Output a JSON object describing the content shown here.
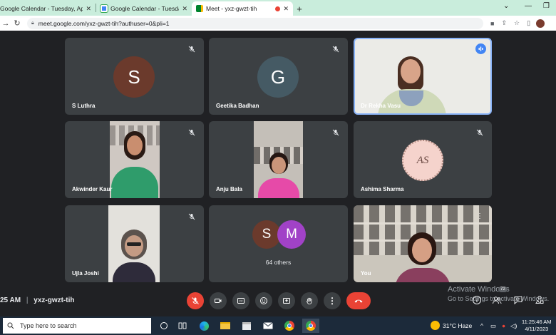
{
  "browser": {
    "tabs": [
      {
        "title": "Google Calendar - Tuesday, April",
        "active": false
      },
      {
        "title": "Google Calendar - Tuesday, April",
        "active": false
      },
      {
        "title": "Meet - yxz-gwzt-tih",
        "active": true
      }
    ],
    "new_tab_label": "+",
    "url": "meet.google.com/yxz-gwzt-tih?authuser=0&pli=1"
  },
  "meeting": {
    "participants": [
      {
        "name": "S Luthra",
        "initial": "S",
        "avatar_color": "#6b3a2c",
        "muted": true
      },
      {
        "name": "Geetika Badhan",
        "initial": "G",
        "avatar_color": "#455a64",
        "muted": true
      },
      {
        "name": "Dr Rekha Vasu",
        "speaking": true
      },
      {
        "name": "Akwinder Kaur",
        "muted": true
      },
      {
        "name": "Anju Bala",
        "muted": true
      },
      {
        "name": "Ashima Sharma",
        "avatar_text": "AS",
        "muted": true
      },
      {
        "name": "Ujla Joshi",
        "muted": true
      },
      {
        "others_label": "64 others",
        "initials": [
          "S",
          "M"
        ]
      },
      {
        "name": "You"
      }
    ],
    "time_fragment": "25 AM",
    "separator": "|",
    "code": "yxz-gwzt-tih",
    "people_count": "72",
    "watermark_line1": "Activate Windows",
    "watermark_line2": "Go to Settings to activate Windows."
  },
  "taskbar": {
    "search_placeholder": "Type here to search",
    "weather": "31°C  Haze",
    "time": "11:25:46 AM",
    "date": "4/11/2023"
  },
  "colors": {
    "accent": "#1a73e8",
    "danger": "#ea4335",
    "tile": "#3c4043",
    "background": "#202124"
  }
}
